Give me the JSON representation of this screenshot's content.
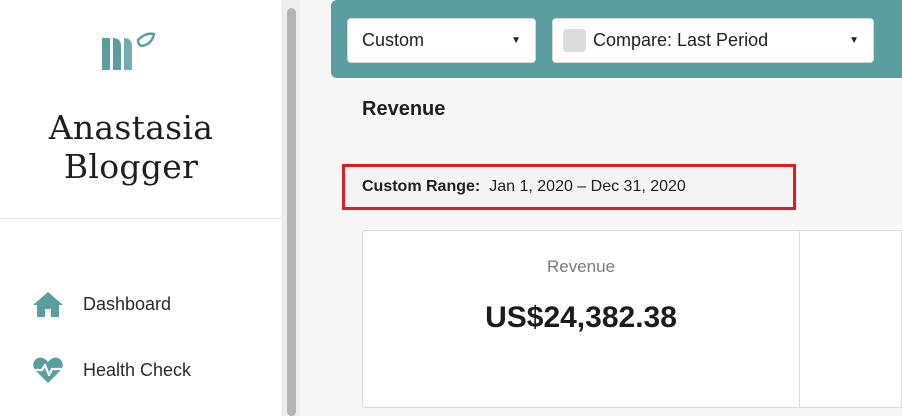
{
  "brand": {
    "line1": "Anastasia",
    "line2": "Blogger"
  },
  "sidebar": {
    "items": [
      {
        "label": "Dashboard",
        "icon": "home-icon"
      },
      {
        "label": "Health Check",
        "icon": "heart-pulse-icon"
      }
    ]
  },
  "toolbar": {
    "range_select": {
      "value": "Custom"
    },
    "compare_select": {
      "value": "Compare: Last Period",
      "checked": false
    }
  },
  "section": {
    "title": "Revenue"
  },
  "range": {
    "label": "Custom Range:",
    "value": "Jan 1, 2020 – Dec 31, 2020"
  },
  "metric": {
    "label": "Revenue",
    "value": "US$24,382.38"
  },
  "colors": {
    "accent": "#5b9ea0",
    "highlight": "#e01b22"
  }
}
